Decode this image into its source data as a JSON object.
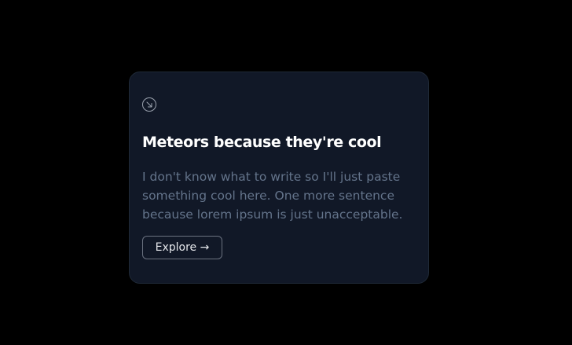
{
  "card": {
    "icon": "arrow-down-right-icon",
    "title": "Meteors because they're cool",
    "description": "I don't know what to write so I'll just paste something cool here. One more sentence because lorem ipsum is just unacceptable.",
    "button_label": "Explore →"
  },
  "colors": {
    "page_background": "#000000",
    "card_background": "#111827",
    "title_text": "#ffffff",
    "body_text": "#64748b",
    "button_border": "#6b7280"
  }
}
